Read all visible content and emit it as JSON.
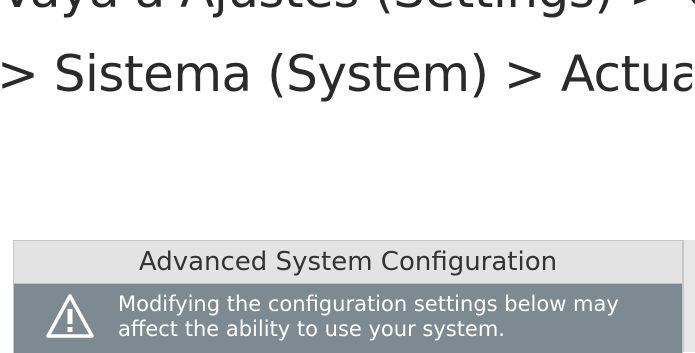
{
  "instruction": {
    "line1": "Vaya a Ajustes (Settings) > Co",
    "line2": "> Sistema (System) > Actualiz"
  },
  "dialog": {
    "title": "Advanced System Configuration",
    "warning": {
      "icon": "warning-triangle-icon",
      "line1": "Modifying the configuration settings below may",
      "line2": "affect the ability to use your system."
    }
  },
  "colors": {
    "warning_bar": "#7e8a92",
    "header_bg": "#e3e3e3",
    "text": "#2a2a2a"
  }
}
